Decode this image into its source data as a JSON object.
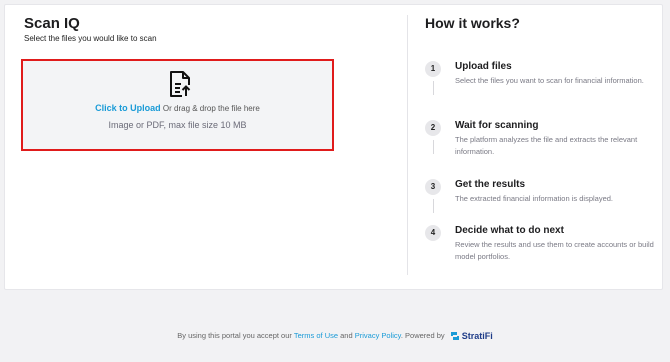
{
  "left": {
    "title": "Scan IQ",
    "subtitle": "Select the files you would like to scan",
    "dropzone": {
      "link_text": "Click to Upload",
      "drag_text": " Or drag & drop the file here",
      "hint": "Image or PDF, max file size 10 MB",
      "icon": "file-upload-icon",
      "border_color": "#e01b1b"
    }
  },
  "how": {
    "title": "How it works?",
    "steps": [
      {
        "num": "1",
        "title": "Upload files",
        "desc": "Select the files you want to scan for financial information."
      },
      {
        "num": "2",
        "title": "Wait for scanning",
        "desc": "The platform analyzes the file and extracts the relevant information."
      },
      {
        "num": "3",
        "title": "Get the results",
        "desc": "The extracted financial information is displayed."
      },
      {
        "num": "4",
        "title": "Decide what to do next",
        "desc": "Review the results and use them to create accounts or build model portfolios."
      }
    ]
  },
  "footer": {
    "prefix": "By using this portal you accept our ",
    "terms": "Terms of Use",
    "and": " and ",
    "privacy": "Privacy Policy",
    "powered": ". Powered by ",
    "brand": "StratiFi",
    "link_color": "#1a9bd7"
  }
}
